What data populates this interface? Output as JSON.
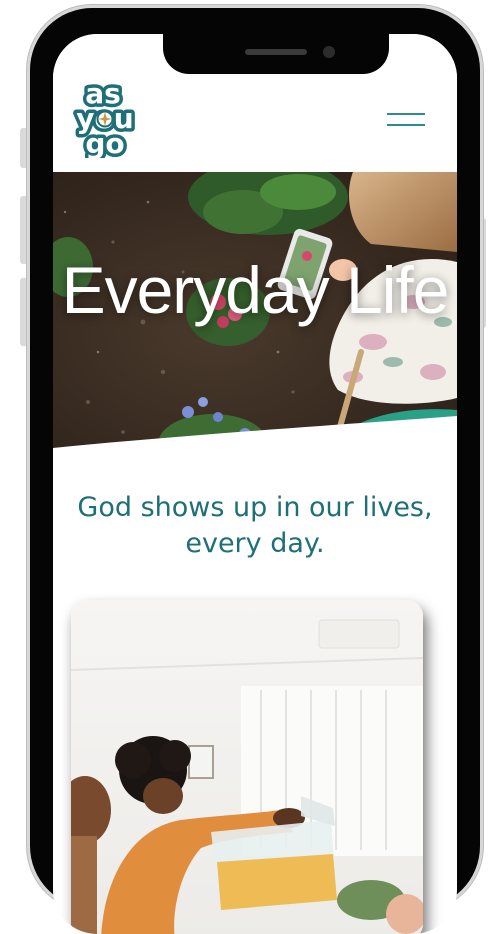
{
  "brand": {
    "logo_line1": "as",
    "logo_line2": "you",
    "logo_line3": "go"
  },
  "hero": {
    "title": "Everyday Life"
  },
  "tagline": {
    "line1": "God shows up in our lives,",
    "line2": "every day."
  },
  "colors": {
    "teal": "#1e6f78",
    "accent": "#2d8b95",
    "logo_white": "#ffffff"
  },
  "icons": {
    "menu": "hamburger-menu-icon",
    "compass": "compass-icon"
  }
}
